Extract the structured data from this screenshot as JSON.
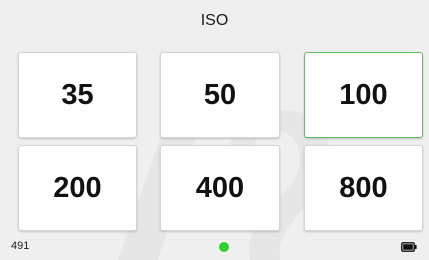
{
  "header": {
    "title": "ISO"
  },
  "iso_options": [
    {
      "label": "35",
      "selected": false
    },
    {
      "label": "50",
      "selected": false
    },
    {
      "label": "100",
      "selected": true
    },
    {
      "label": "200",
      "selected": false
    },
    {
      "label": "400",
      "selected": false
    },
    {
      "label": "800",
      "selected": false
    }
  ],
  "footer": {
    "left_text": "491",
    "page_indicator_icon": "page-dot",
    "battery_icon": "battery-full"
  },
  "colors": {
    "selected_border": "#59c057",
    "page_dot": "#2ed12e",
    "background": "#efefef"
  }
}
